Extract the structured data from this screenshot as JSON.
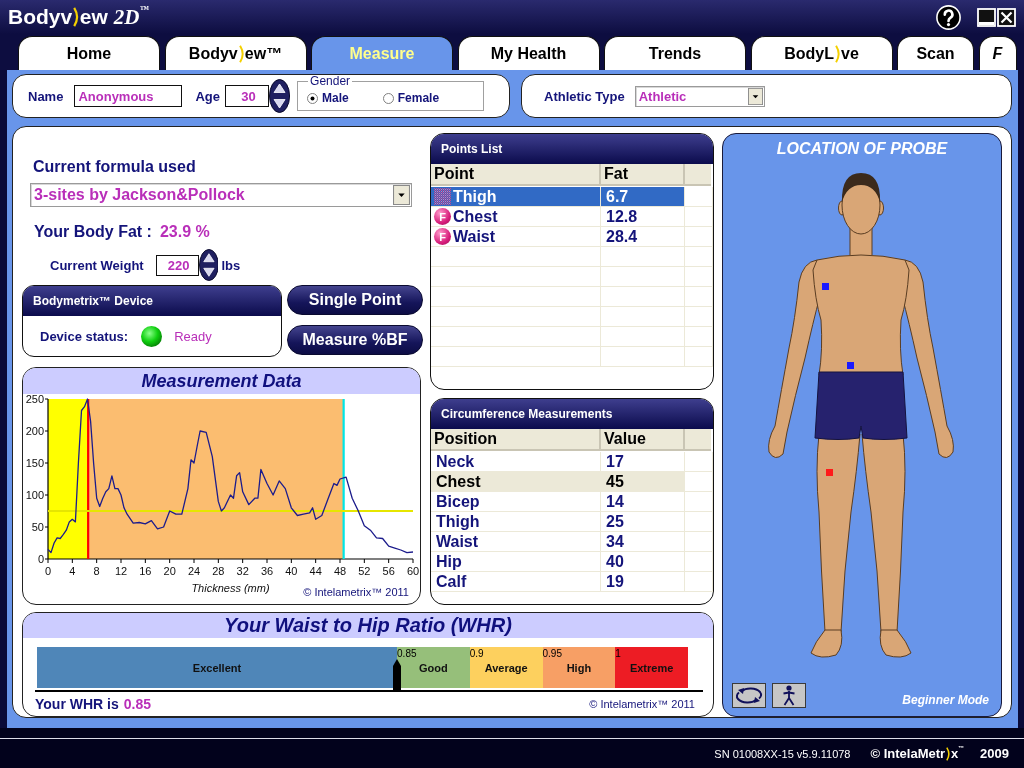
{
  "title_bar": {
    "logo_start": "Bodyv",
    "logo_end": "ew",
    "edition": "2D$^{™}$"
  },
  "tabs": [
    {
      "label": "Home",
      "kind": "text",
      "selected": false
    },
    {
      "label": "Bodyv",
      "label_end": "ew™",
      "kind": "logo",
      "selected": false
    },
    {
      "label": "Measure",
      "kind": "text",
      "selected": true
    },
    {
      "label": "My Health",
      "kind": "text",
      "selected": false
    },
    {
      "label": "Trends",
      "kind": "text",
      "selected": false
    },
    {
      "label": "BodyL",
      "label_end": "ve",
      "kind": "logo",
      "selected": false
    },
    {
      "label": "Scan",
      "kind": "text",
      "selected": false
    },
    {
      "label": "F",
      "kind": "italic",
      "selected": false
    }
  ],
  "profile": {
    "name_label": "Name",
    "name_value": "Anonymous",
    "age_label": "Age",
    "age_value": "30",
    "gender": {
      "legend": "Gender",
      "options": [
        {
          "label": "Male",
          "selected": true
        },
        {
          "label": "Female",
          "selected": false
        }
      ]
    }
  },
  "athletic": {
    "label": "Athletic Type",
    "value": "Athletic"
  },
  "formula": {
    "label": "Current formula used",
    "value": "3-sites by Jackson&Pollock"
  },
  "body_fat": {
    "label": "Your Body Fat :",
    "value": "23.9 %"
  },
  "weight": {
    "label": "Current Weight",
    "value": "220",
    "unit": "lbs"
  },
  "device": {
    "title": "Bodymetrix™ Device",
    "status_label": "Device status:",
    "status": "Ready"
  },
  "actions": [
    "Single Point",
    "Measure %BF"
  ],
  "measurement": {
    "chart_data": {
      "type": "line",
      "title": "Measurement Data",
      "xlabel": "Thickness (mm)",
      "x": [
        0,
        0.5,
        1,
        1.5,
        2,
        2.5,
        3,
        3.5,
        4,
        4.5,
        5,
        5.5,
        6,
        6.5,
        7,
        7.5,
        8,
        8.5,
        9,
        9.5,
        10,
        10.5,
        11,
        11.5,
        12,
        12.5,
        13,
        14,
        15,
        16,
        17,
        18,
        19,
        20,
        21,
        22,
        23,
        23.5,
        24,
        24.5,
        25,
        26,
        27,
        28,
        28.5,
        29,
        30,
        30.5,
        31,
        31.5,
        32,
        33,
        34,
        34.5,
        35,
        36,
        37,
        38,
        39,
        40,
        41,
        42,
        43,
        43.5,
        44,
        45,
        46,
        47,
        47.5,
        48,
        49,
        50,
        51,
        52,
        53,
        54,
        55,
        56,
        57,
        58,
        59,
        60
      ],
      "series": [
        {
          "values": [
            15,
            10,
            25,
            33,
            32,
            38,
            45,
            58,
            62,
            58,
            150,
            232,
            238,
            250,
            215,
            150,
            95,
            82,
            95,
            105,
            110,
            130,
            110,
            110,
            100,
            80,
            70,
            56,
            57,
            55,
            60,
            47,
            50,
            75,
            70,
            70,
            110,
            155,
            150,
            175,
            200,
            198,
            160,
            90,
            75,
            80,
            100,
            95,
            130,
            135,
            105,
            85,
            95,
            95,
            140,
            118,
            100,
            122,
            110,
            80,
            68,
            70,
            72,
            80,
            62,
            68,
            93,
            118,
            115,
            125,
            128,
            95,
            75,
            52,
            45,
            33,
            32,
            20,
            17,
            14,
            10,
            11
          ]
        }
      ],
      "xlim": [
        0,
        60
      ],
      "ylim": [
        0,
        250
      ],
      "xticks": [
        0,
        4,
        8,
        12,
        16,
        20,
        24,
        28,
        32,
        36,
        40,
        44,
        48,
        52,
        56,
        60
      ],
      "yticks": [
        0,
        50,
        100,
        150,
        200,
        250
      ],
      "bands": [
        {
          "axis": "x",
          "from": 0,
          "to": 6.6,
          "color": "#ffff00"
        },
        {
          "axis": "x",
          "from": 6.6,
          "to": 48.6,
          "color": "#fbbd70"
        }
      ],
      "ref_lines": [
        {
          "axis": "x",
          "value": 6.6,
          "color": "#ff0000"
        },
        {
          "axis": "x",
          "value": 48.6,
          "color": "#00e5e5"
        },
        {
          "axis": "y",
          "value": 75,
          "color": "#e6e600"
        }
      ]
    },
    "credit": "© Intelametrix™ 2011"
  },
  "points_list": {
    "title": "Points List",
    "columns": [
      "Point",
      "Fat"
    ],
    "rows": [
      {
        "point": "Thigh",
        "fat": "6.7",
        "selected": true
      },
      {
        "point": "Chest",
        "fat": "12.8",
        "badge": "F",
        "selected": false
      },
      {
        "point": "Waist",
        "fat": "28.4",
        "badge": "F",
        "selected": false
      }
    ]
  },
  "circumference": {
    "title": "Circumference Measurements",
    "columns": [
      "Position",
      "Value"
    ],
    "rows": [
      {
        "position": "Neck",
        "value": "17",
        "selected": false
      },
      {
        "position": "Chest",
        "value": "45",
        "selected": true
      },
      {
        "position": "Bicep",
        "value": "14",
        "selected": false
      },
      {
        "position": "Thigh",
        "value": "25",
        "selected": false
      },
      {
        "position": "Waist",
        "value": "34",
        "selected": false
      },
      {
        "position": "Hip",
        "value": "40",
        "selected": false
      },
      {
        "position": "Calf",
        "value": "19",
        "selected": false
      }
    ]
  },
  "whr": {
    "title": "Your Waist to Hip Ratio (WHR)",
    "segments": [
      {
        "label": "Excellent",
        "color": "#4f86b8"
      },
      {
        "label": "Good",
        "tick": "0.85",
        "color": "#96bf7a"
      },
      {
        "label": "Average",
        "tick": "0.9",
        "color": "#fdd05e"
      },
      {
        "label": "High",
        "tick": "0.95",
        "color": "#f79f65"
      },
      {
        "label": "Extreme",
        "tick": "1",
        "color": "#ed1c24"
      }
    ],
    "marker": {
      "level": 0.553
    },
    "result_label": "Your WHR is",
    "result_value": "0.85",
    "credit": "© Intelametrix™ 2011"
  },
  "probe_view": {
    "title": "LOCATION OF PROBE",
    "mode": "Beginner Mode"
  },
  "footer": {
    "serial": "SN 01008XX-15 v5.9.11078",
    "brand_start": "© IntelaMetr",
    "brand_end": "x$^{™}$",
    "year": "2009"
  }
}
